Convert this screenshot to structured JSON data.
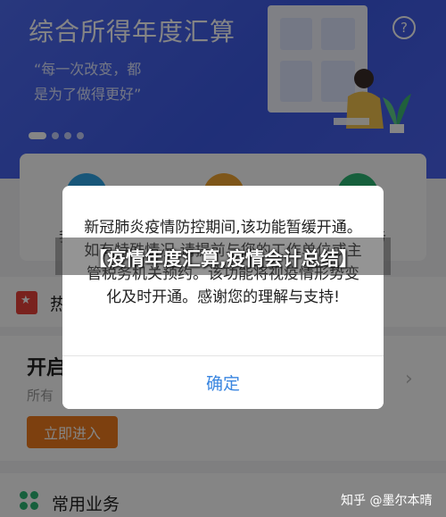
{
  "banner": {
    "title": "综合所得年度汇算",
    "subtitle": "“每一次改变，都是为了做得更好”",
    "help_label": "?"
  },
  "services": {
    "item_1_label": "我",
    "item_3_label": "务"
  },
  "hot": {
    "icon_text": "★",
    "label": "热"
  },
  "open_card": {
    "title": "开启",
    "subtitle": "所有",
    "arrow": "›",
    "enter_label": "立即进入"
  },
  "common": {
    "label": "常用业务"
  },
  "dialog": {
    "message": "新冠肺炎疫情防控期间,该功能暂缓开通。如有特殊情况,请提前与您的工作单位或主管税务机关预约。该功能将视疫情形势变化及时开通。感谢您的理解与支持!",
    "confirm_label": "确定"
  },
  "headline": "【疫情年度汇算,疫情会计总结】",
  "watermark": "知乎 @墨尔本晴",
  "colors": {
    "banner_blue": "#4e6bf0",
    "dialog_button": "#3a86e0",
    "enter_button": "#f07c1e",
    "hot_red": "#e8413b",
    "common_green": "#2bb673"
  }
}
